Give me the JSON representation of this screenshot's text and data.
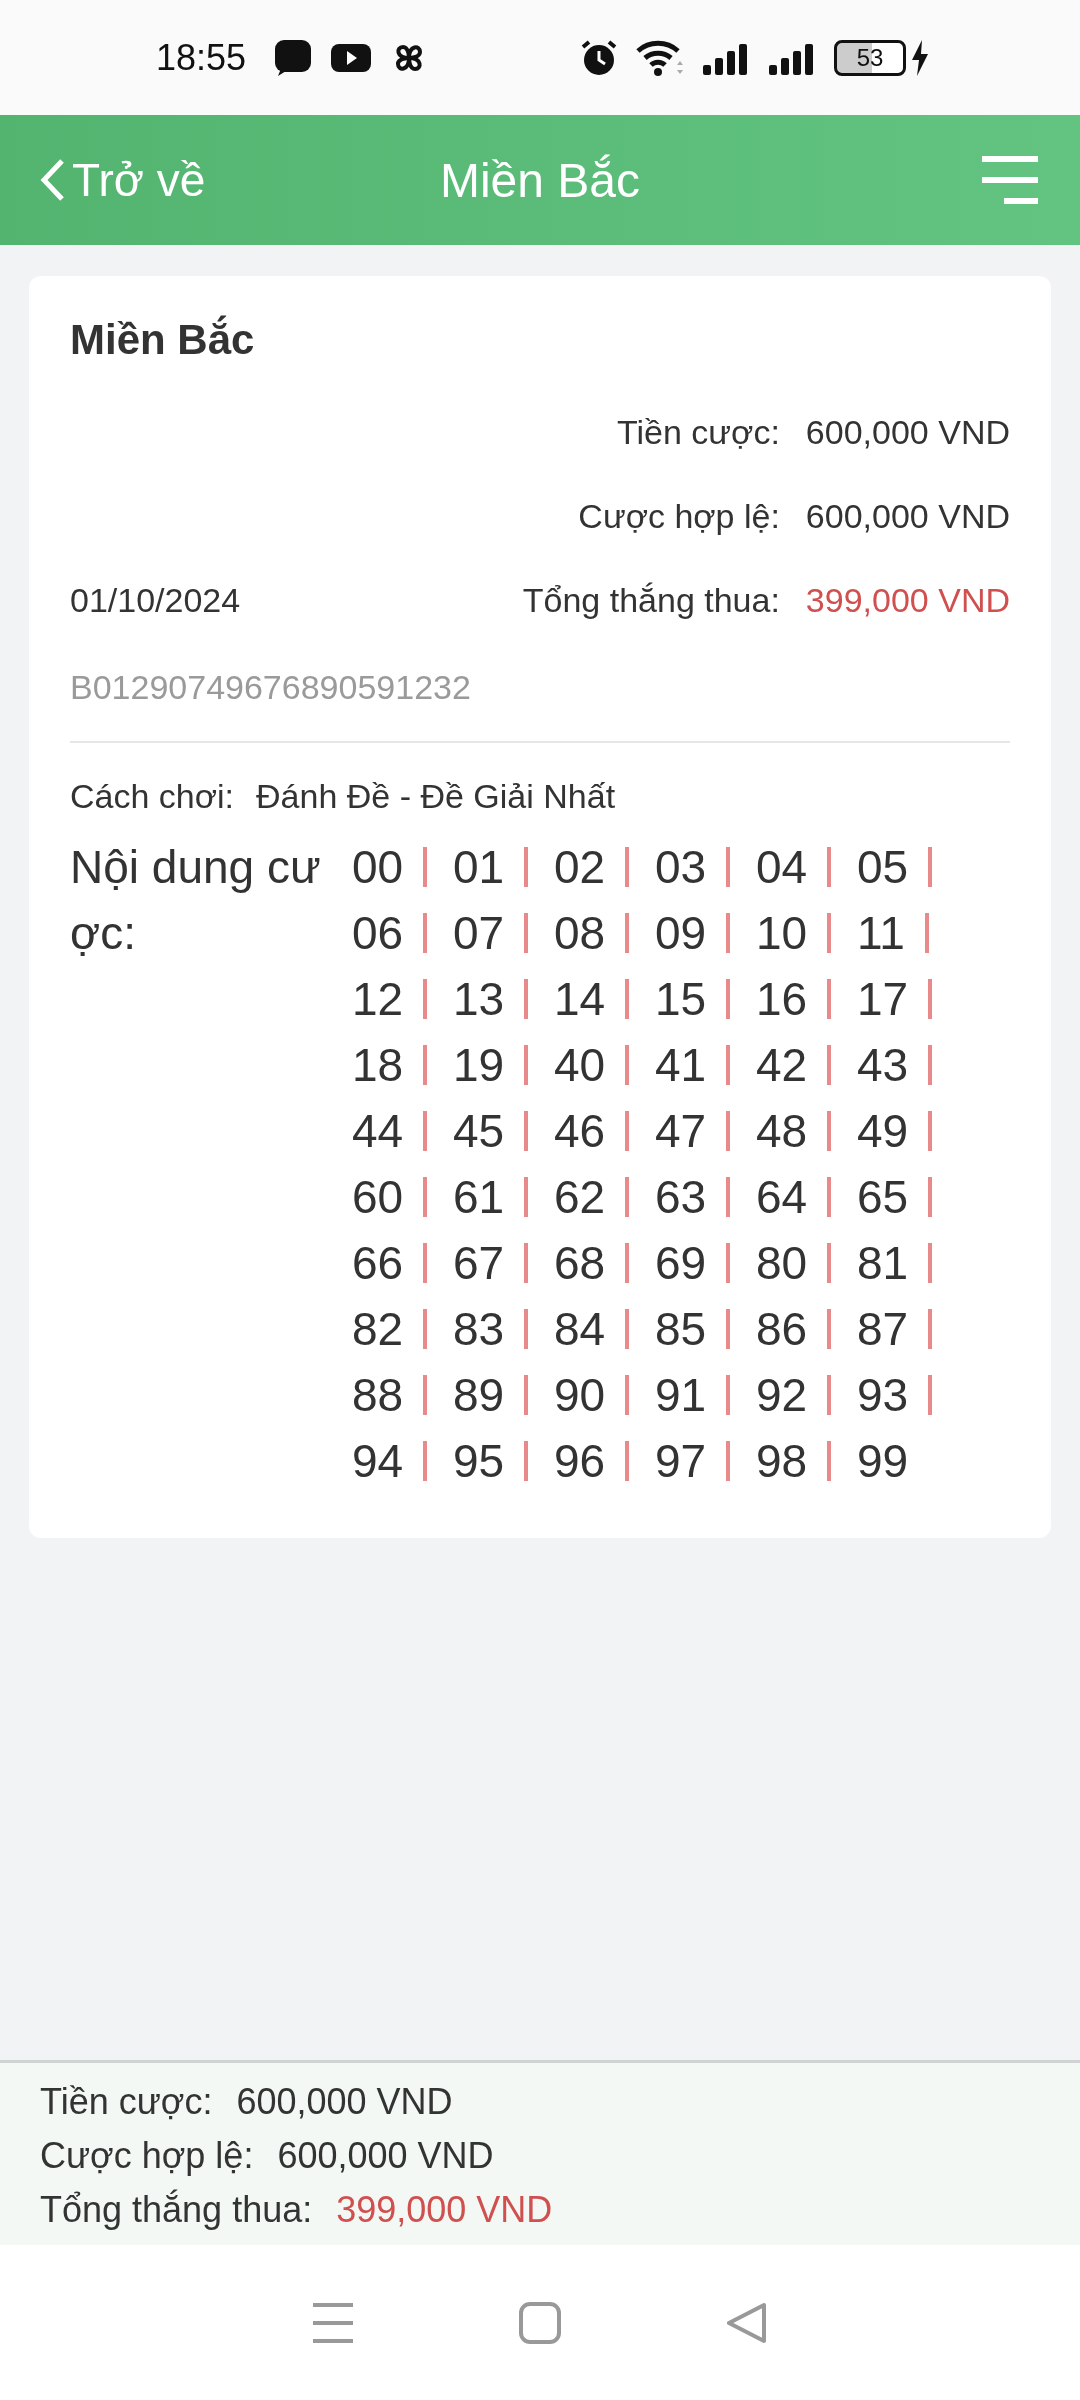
{
  "status_bar": {
    "time": "18:55",
    "battery": "53"
  },
  "header": {
    "back_label": "Trở về",
    "title": "Miền Bắc"
  },
  "card": {
    "title": "Miền Bắc",
    "date": "01/10/2024",
    "order_id": "B01290749676890591232",
    "details": [
      {
        "label": "Tiền cược:",
        "value": "600,000 VND",
        "kind": "plain"
      },
      {
        "label": "Cược hợp lệ:",
        "value": "600,000 VND",
        "kind": "plain"
      },
      {
        "label": "Tổng thắng thua:",
        "value": "399,000 VND",
        "kind": "result"
      }
    ],
    "play_label": "Cách chơi:",
    "play_value": "Đánh Đề - Đề Giải Nhất",
    "content_label": "Nội dung cược:",
    "numbers": [
      "00",
      "01",
      "02",
      "03",
      "04",
      "05",
      "06",
      "07",
      "08",
      "09",
      "10",
      "11",
      "12",
      "13",
      "14",
      "15",
      "16",
      "17",
      "18",
      "19",
      "40",
      "41",
      "42",
      "43",
      "44",
      "45",
      "46",
      "47",
      "48",
      "49",
      "60",
      "61",
      "62",
      "63",
      "64",
      "65",
      "66",
      "67",
      "68",
      "69",
      "80",
      "81",
      "82",
      "83",
      "84",
      "85",
      "86",
      "87",
      "88",
      "89",
      "90",
      "91",
      "92",
      "93",
      "94",
      "95",
      "96",
      "97",
      "98",
      "99"
    ]
  },
  "summary": [
    {
      "label": "Tiền cược:",
      "value": "600,000 VND",
      "kind": "plain"
    },
    {
      "label": "Cược hợp lệ:",
      "value": "600,000 VND",
      "kind": "plain"
    },
    {
      "label": "Tổng thắng thua:",
      "value": "399,000 VND",
      "kind": "result"
    }
  ]
}
